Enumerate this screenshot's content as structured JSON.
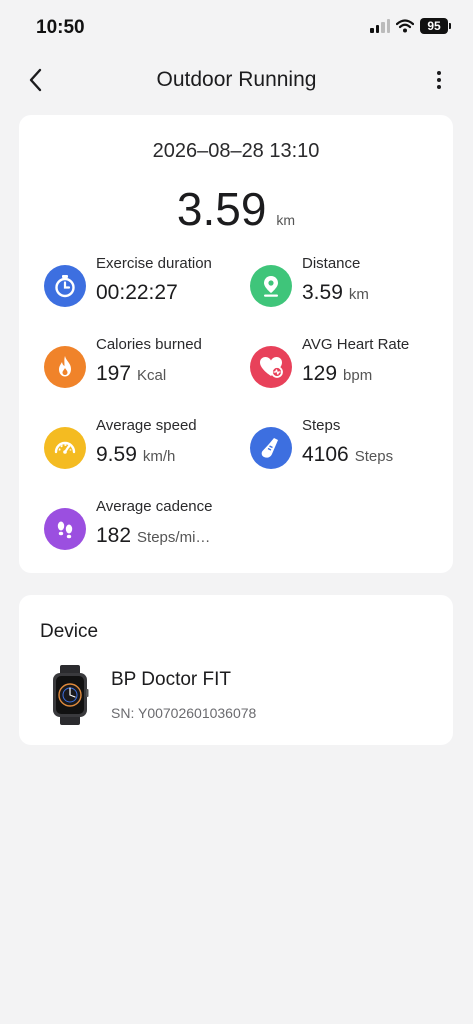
{
  "status_bar": {
    "time": "10:50",
    "battery": "95",
    "icons": [
      "signal-icon",
      "wifi-icon",
      "battery-icon"
    ]
  },
  "nav": {
    "back_icon": "chevron-left-icon",
    "title": "Outdoor Running",
    "more_icon": "more-vertical-icon"
  },
  "summary": {
    "datetime": "2026–08–28 13:10",
    "distance_value": "3.59",
    "distance_unit": "km",
    "metrics": [
      {
        "label": "Exercise duration",
        "value": "00:22:27",
        "unit": "",
        "icon": "stopwatch-icon",
        "color": "#3d6fe0"
      },
      {
        "label": "Distance",
        "value": "3.59",
        "unit": "km",
        "icon": "location-pin-icon",
        "color": "#3fc57a"
      },
      {
        "label": "Calories burned",
        "value": "197",
        "unit": "Kcal",
        "icon": "flame-icon",
        "color": "#f0832a"
      },
      {
        "label": "AVG Heart Rate",
        "value": "129",
        "unit": "bpm",
        "icon": "heart-rate-icon",
        "color": "#e8415a"
      },
      {
        "label": "Average speed",
        "value": "9.59",
        "unit": "km/h",
        "icon": "speedometer-icon",
        "color": "#f4bb21"
      },
      {
        "label": "Steps",
        "value": "4106",
        "unit": "Steps",
        "icon": "shoe-icon",
        "color": "#3d6fe0"
      },
      {
        "label": "Average cadence",
        "value": "182",
        "unit": "Steps/mi…",
        "icon": "footprints-icon",
        "color": "#9b4fe0"
      }
    ]
  },
  "device": {
    "section_title": "Device",
    "name": "BP Doctor FIT",
    "sn": "SN: Y00702601036078",
    "icon": "smartwatch-icon"
  }
}
